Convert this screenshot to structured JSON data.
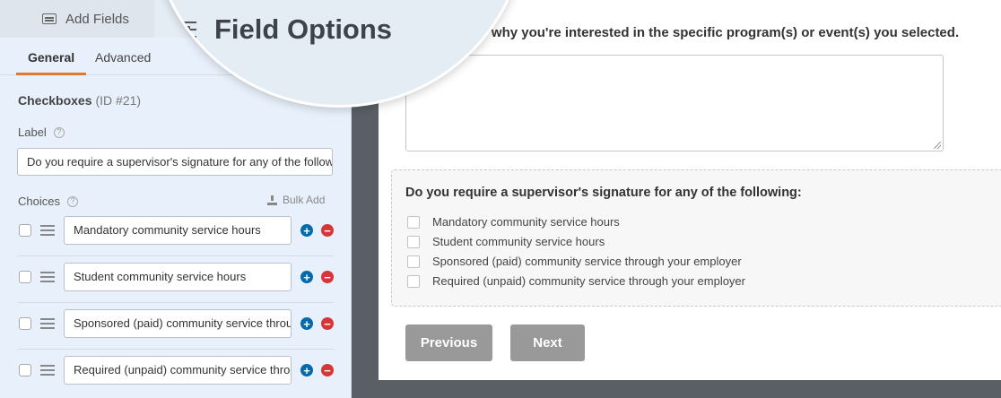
{
  "sidebar": {
    "add_fields_tab": "Add Fields",
    "field_options_tab": "Field Options",
    "subtabs": {
      "general": "General",
      "advanced": "Advanced"
    },
    "field_type": "Checkboxes",
    "field_id": "(ID #21)",
    "label_caption": "Label",
    "label_value": "Do you require a supervisor's signature for any of the following:",
    "choices_caption": "Choices",
    "bulk_add": "Bulk Add",
    "choices": [
      "Mandatory community service hours",
      "Student community service hours",
      "Sponsored (paid) community service through your employer",
      "Required (unpaid) community service through your employer"
    ],
    "help_glyph": "?",
    "add_glyph": "+",
    "remove_glyph": "−"
  },
  "preview": {
    "question": "Please share why you're interested in the specific program(s) or event(s) you selected.",
    "checkbox_label": "Do you require a supervisor's signature for any of the following:",
    "options": [
      "Mandatory community service hours",
      "Student community service hours",
      "Sponsored (paid) community service through your employer",
      "Required (unpaid) community service through your employer"
    ],
    "previous_button": "Previous",
    "next_button": "Next"
  },
  "colors": {
    "accent_tab": "#e27730",
    "add_choice": "#036aab",
    "remove_choice": "#d63638",
    "preview_backdrop": "#5a5f66",
    "button_gray": "#999999"
  },
  "icons": {
    "add_fields": "list-icon",
    "field_options": "sliders-icon",
    "help": "help-icon",
    "bulk_add": "download-icon",
    "drag": "drag-handle-icon",
    "add_choice": "plus-circle-icon",
    "remove_choice": "minus-circle-icon"
  }
}
